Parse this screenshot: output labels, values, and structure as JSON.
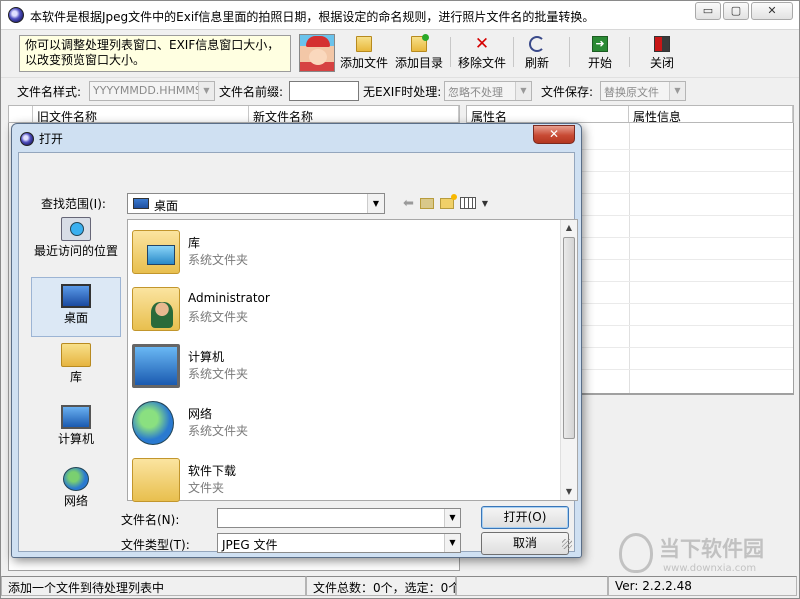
{
  "app": {
    "title": "本软件是根据Jpeg文件中的Exif信息里面的拍照日期，根据设定的命名规则，进行照片文件名的批量转换。",
    "tip": "你可以调整处理列表窗口、EXIF信息窗口大小，以改变预览窗口大小。",
    "window_buttons": {
      "minimize": "▭",
      "maximize": "▢",
      "close": "✕"
    }
  },
  "toolbar": [
    {
      "label": "添加文件",
      "icon": "add-file-icon"
    },
    {
      "label": "添加目录",
      "icon": "add-folder-icon"
    },
    {
      "label": "移除文件",
      "icon": "remove-icon"
    },
    {
      "label": "刷新",
      "icon": "refresh-icon"
    },
    {
      "label": "开始",
      "icon": "start-icon"
    },
    {
      "label": "关闭",
      "icon": "close-app-icon"
    }
  ],
  "options": {
    "filename_pattern_label": "文件名样式:",
    "filename_pattern_value": "YYYYMMDD.HHMMSS",
    "filename_prefix_label": "文件名前缀:",
    "filename_prefix_value": "",
    "no_exif_label": "无EXIF时处理:",
    "no_exif_value": "忽略不处理",
    "save_label": "文件保存:",
    "save_value": "替换原文件"
  },
  "list": {
    "columns": [
      "旧文件名称",
      "新文件名称"
    ],
    "info_columns": [
      "属性名",
      "属性信息"
    ]
  },
  "status": {
    "message": "添加一个文件到待处理列表中",
    "counts": "文件总数：0个，选定：0个",
    "version": "Ver: 2.2.2.48"
  },
  "watermark": {
    "brand": "当下软件园",
    "url": "www.downxia.com"
  },
  "dialog": {
    "title": "打开",
    "close": "✕",
    "look_in_label": "查找范围(I):",
    "look_in_value": "桌面",
    "places": [
      "最近访问的位置",
      "桌面",
      "库",
      "计算机",
      "网络"
    ],
    "selected_place": "桌面",
    "files": [
      {
        "name": "库",
        "type": "系统文件夹",
        "icon": "library-icon"
      },
      {
        "name": "Administrator",
        "type": "系统文件夹",
        "icon": "user-folder-icon"
      },
      {
        "name": "计算机",
        "type": "系统文件夹",
        "icon": "computer-icon"
      },
      {
        "name": "网络",
        "type": "系统文件夹",
        "icon": "network-icon"
      },
      {
        "name": "软件下载",
        "type": "文件夹",
        "icon": "folder-icon"
      }
    ],
    "filename_label": "文件名(N):",
    "filename_value": "",
    "filetype_label": "文件类型(T):",
    "filetype_value": "JPEG 文件",
    "open_button": "打开(O)",
    "cancel_button": "取消"
  }
}
